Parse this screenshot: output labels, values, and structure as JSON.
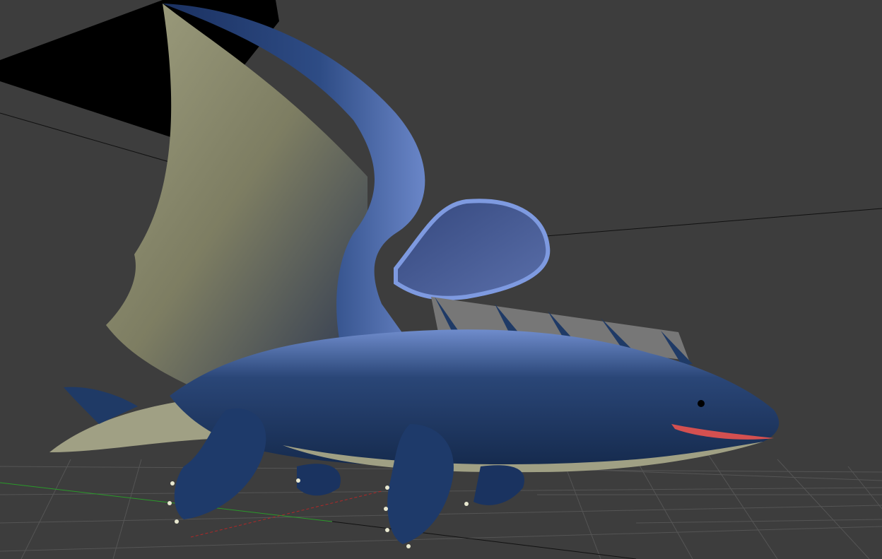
{
  "viewport": {
    "background_color": "#3d3d3d",
    "grid_color": "#5a5a5a",
    "axis_x_color": "#a02020",
    "axis_z_color": "#20a020",
    "model": {
      "body_color": "#1f3a66",
      "highlight_color": "#7f9ad8",
      "membrane_color": "#8a8a6e",
      "belly_color": "#a0a084"
    }
  }
}
